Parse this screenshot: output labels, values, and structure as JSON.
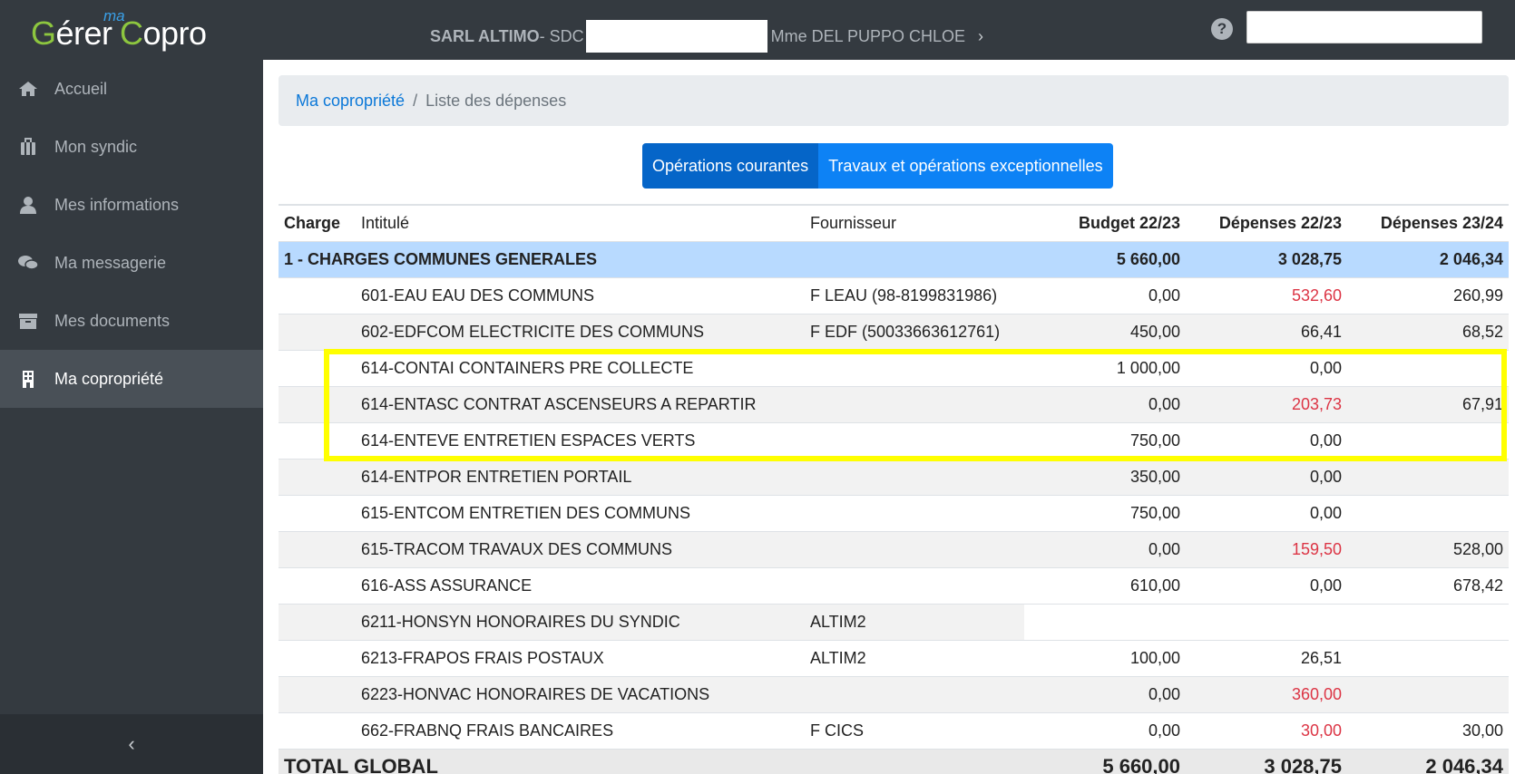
{
  "header": {
    "logo": {
      "part1_g": "G",
      "part1_rest": "érer",
      "part2_g": "C",
      "part2_rest": "opro",
      "superscript": "ma"
    },
    "organization": "SARL ALTIMO",
    "sdc_prefix": " - SDC",
    "owner": "Mme DEL PUPPO CHLOE",
    "help_icon": "question-circle-icon"
  },
  "sidebar": {
    "items": [
      {
        "label": "Accueil",
        "icon": "home-icon"
      },
      {
        "label": "Mon syndic",
        "icon": "building-icon"
      },
      {
        "label": "Mes informations",
        "icon": "user-icon"
      },
      {
        "label": "Ma messagerie",
        "icon": "chat-icon"
      },
      {
        "label": "Mes documents",
        "icon": "archive-icon"
      },
      {
        "label": "Ma copropriété",
        "icon": "apartment-icon",
        "active": true
      }
    ],
    "collapse_label": "‹"
  },
  "breadcrumb": {
    "link": "Ma copropriété",
    "separator": "/",
    "current": "Liste des dépenses"
  },
  "tabs": [
    "Opérations courantes",
    "Travaux et opérations exceptionnelles"
  ],
  "table": {
    "headers": {
      "charge": "Charge",
      "intitule": "Intitulé",
      "fournisseur": "Fournisseur",
      "budget": "Budget 22/23",
      "dep1": "Dépenses 22/23",
      "dep2": "Dépenses 23/24"
    },
    "group": {
      "label": "1 - CHARGES COMMUNES GENERALES",
      "budget": "5 660,00",
      "dep1": "3 028,75",
      "dep2": "2 046,34"
    },
    "rows": [
      {
        "intitule": "601-EAU EAU DES COMMUNS",
        "fournisseur": "F LEAU (98-8199831986)",
        "budget": "0,00",
        "dep1": "532,60",
        "dep1_neg": true,
        "dep2": "260,99"
      },
      {
        "intitule": "602-EDFCOM ELECTRICITE DES COMMUNS",
        "fournisseur": "F EDF (50033663612761)",
        "budget": "450,00",
        "dep1": "66,41",
        "dep2": "68,52"
      },
      {
        "intitule": "614-CONTAI CONTAINERS PRE COLLECTE",
        "fournisseur": "",
        "budget": "1 000,00",
        "dep1": "0,00",
        "dep2": ""
      },
      {
        "intitule": "614-ENTASC CONTRAT ASCENSEURS A REPARTIR",
        "fournisseur": "",
        "budget": "0,00",
        "dep1": "203,73",
        "dep1_neg": true,
        "dep2": "67,91"
      },
      {
        "intitule": "614-ENTEVE ENTRETIEN ESPACES VERTS",
        "fournisseur": "",
        "budget": "750,00",
        "dep1": "0,00",
        "dep2": ""
      },
      {
        "intitule": "614-ENTPOR ENTRETIEN PORTAIL",
        "fournisseur": "",
        "budget": "350,00",
        "dep1": "0,00",
        "dep2": ""
      },
      {
        "intitule": "615-ENTCOM ENTRETIEN DES COMMUNS",
        "fournisseur": "",
        "budget": "750,00",
        "dep1": "0,00",
        "dep2": ""
      },
      {
        "intitule": "615-TRACOM TRAVAUX DES COMMUNS",
        "fournisseur": "",
        "budget": "0,00",
        "dep1": "159,50",
        "dep1_neg": true,
        "dep2": "528,00"
      },
      {
        "intitule": "616-ASS ASSURANCE",
        "fournisseur": "",
        "budget": "610,00",
        "dep1": "0,00",
        "dep2": "678,42"
      },
      {
        "intitule": "6211-HONSYN HONORAIRES DU SYNDIC",
        "fournisseur": "ALTIM2",
        "budget": "",
        "dep1": "",
        "dep2": "",
        "blank": true
      },
      {
        "intitule": "6213-FRAPOS FRAIS POSTAUX",
        "fournisseur": "ALTIM2",
        "budget": "100,00",
        "dep1": "26,51",
        "dep2": ""
      },
      {
        "intitule": "6223-HONVAC HONORAIRES DE VACATIONS",
        "fournisseur": "",
        "budget": "0,00",
        "dep1": "360,00",
        "dep1_neg": true,
        "dep2": ""
      },
      {
        "intitule": "662-FRABNQ FRAIS BANCAIRES",
        "fournisseur": "F CICS",
        "budget": "0,00",
        "dep1": "30,00",
        "dep1_neg": true,
        "dep2": "30,00"
      }
    ],
    "total": {
      "label": "TOTAL GLOBAL",
      "budget": "5 660,00",
      "dep1": "3 028,75",
      "dep2": "2 046,34"
    }
  }
}
